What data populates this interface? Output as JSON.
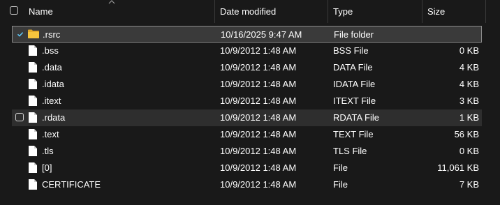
{
  "header": {
    "columns": {
      "name": "Name",
      "date_modified": "Date modified",
      "type": "Type",
      "size": "Size"
    },
    "sorted_by": "name",
    "sort_direction": "ascending"
  },
  "files": [
    {
      "name": ".rsrc",
      "date": "10/16/2025 9:47 AM",
      "type": "File folder",
      "size": "",
      "icon": "folder-icon",
      "checked": true,
      "selected": true
    },
    {
      "name": ".bss",
      "date": "10/9/2012 1:48 AM",
      "type": "BSS File",
      "size": "0 KB",
      "icon": "file-icon"
    },
    {
      "name": ".data",
      "date": "10/9/2012 1:48 AM",
      "type": "DATA File",
      "size": "4 KB",
      "icon": "file-icon"
    },
    {
      "name": ".idata",
      "date": "10/9/2012 1:48 AM",
      "type": "IDATA File",
      "size": "4 KB",
      "icon": "file-icon"
    },
    {
      "name": ".itext",
      "date": "10/9/2012 1:48 AM",
      "type": "ITEXT File",
      "size": "3 KB",
      "icon": "file-icon"
    },
    {
      "name": ".rdata",
      "date": "10/9/2012 1:48 AM",
      "type": "RDATA File",
      "size": "1 KB",
      "icon": "file-icon",
      "hovered": true
    },
    {
      "name": ".text",
      "date": "10/9/2012 1:48 AM",
      "type": "TEXT File",
      "size": "56 KB",
      "icon": "file-icon"
    },
    {
      "name": ".tls",
      "date": "10/9/2012 1:48 AM",
      "type": "TLS File",
      "size": "0 KB",
      "icon": "file-icon"
    },
    {
      "name": "[0]",
      "date": "10/9/2012 1:48 AM",
      "type": "File",
      "size": "11,061 KB",
      "icon": "file-icon"
    },
    {
      "name": "CERTIFICATE",
      "date": "10/9/2012 1:48 AM",
      "type": "File",
      "size": "7 KB",
      "icon": "file-icon"
    }
  ],
  "colors": {
    "background": "#191919",
    "selected_row": "#3a3a3a",
    "hovered_row": "#2e2e2e",
    "folder": "#f6c43d",
    "check_accent": "#60cdff"
  }
}
